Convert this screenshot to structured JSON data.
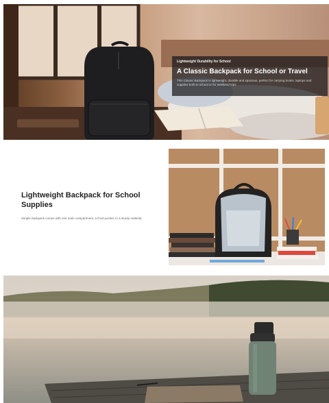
{
  "hero": {
    "eyebrow": "Lightweight Durability for School",
    "title": "A Classic Backpack for School or Travel",
    "description": "This Classic Backpack is lightweight, durable and spacious, perfect for carrying books, laptops and supplies both to school or for weekend trips.",
    "image_alt": "black-backpack-on-desk-photo"
  },
  "feature": {
    "title": "Lightweight Backpack for School Supplies",
    "description": "Simple backpack comes with one main compartment, a front pocket, in a sturdy material.",
    "image_alt": "open-backpack-on-shelf-photo"
  },
  "lifestyle": {
    "image_alt": "water-bottle-lakeside-photo"
  },
  "colors": {
    "panel_bg": "#19191c",
    "title_text": "#222222",
    "body_text": "#666666",
    "backpack": "#1e1e20",
    "bottle": "#6f8274"
  }
}
